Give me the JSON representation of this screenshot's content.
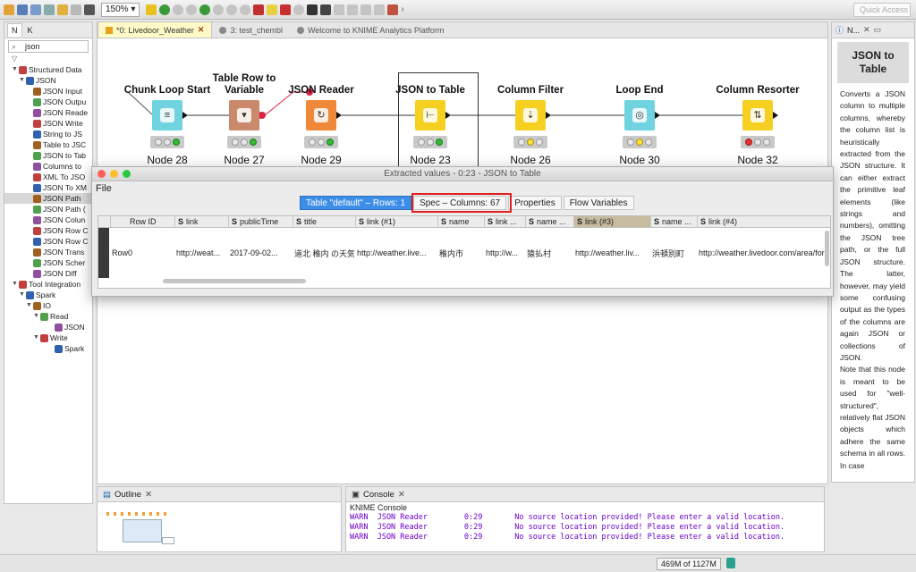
{
  "toolbar": {
    "zoom": "150%",
    "quick_access": "Quick Access"
  },
  "left_panel": {
    "tabs": [
      "N",
      "K"
    ],
    "search_value": "json",
    "tree": [
      {
        "label": "Structured Data",
        "indent": 1,
        "twisty": "▼"
      },
      {
        "label": "JSON",
        "indent": 2,
        "twisty": "▼"
      },
      {
        "label": "JSON Input",
        "indent": 3
      },
      {
        "label": "JSON Outpu",
        "indent": 3
      },
      {
        "label": "JSON Reade",
        "indent": 3
      },
      {
        "label": "JSON Write",
        "indent": 3
      },
      {
        "label": "String to JS",
        "indent": 3
      },
      {
        "label": "Table to JSC",
        "indent": 3
      },
      {
        "label": "JSON to Tab",
        "indent": 3
      },
      {
        "label": "Columns to",
        "indent": 3
      },
      {
        "label": "XML To JSO",
        "indent": 3
      },
      {
        "label": "JSON To XM",
        "indent": 3
      },
      {
        "label": "JSON Path",
        "indent": 3,
        "selected": true
      },
      {
        "label": "JSON Path (",
        "indent": 3
      },
      {
        "label": "JSON Colun",
        "indent": 3
      },
      {
        "label": "JSON Row C",
        "indent": 3
      },
      {
        "label": "JSON Row C",
        "indent": 3
      },
      {
        "label": "JSON Trans",
        "indent": 3
      },
      {
        "label": "JSON Scher",
        "indent": 3
      },
      {
        "label": "JSON Diff",
        "indent": 3
      },
      {
        "label": "Tool Integration",
        "indent": 1,
        "twisty": "▼"
      },
      {
        "label": "Spark",
        "indent": 2,
        "twisty": "▼"
      },
      {
        "label": "IO",
        "indent": 3,
        "twisty": "▼"
      },
      {
        "label": "Read",
        "indent": 4,
        "twisty": "▼"
      },
      {
        "label": "JSON",
        "indent": 6
      },
      {
        "label": "Write",
        "indent": 4,
        "twisty": "▼"
      },
      {
        "label": "Spark",
        "indent": 6
      }
    ]
  },
  "editor": {
    "tabs": [
      {
        "label": "*0: Livedoor_Weather",
        "active": true
      },
      {
        "label": "3: test_chembl",
        "active": false
      },
      {
        "label": "Welcome to KNIME Analytics Platform",
        "active": false
      }
    ]
  },
  "nodes": [
    {
      "title": "Chunk Loop Start",
      "label": "Node 28",
      "color": "#6fd4e0",
      "icon": "≡",
      "lights": [
        "off",
        "off",
        "green"
      ]
    },
    {
      "title": "Table Row to Variable",
      "label": "Node 27",
      "color": "#c9896a",
      "icon": "▾",
      "lights": [
        "off",
        "off",
        "green"
      ]
    },
    {
      "title": "JSON Reader",
      "label": "Node 29",
      "color": "#f0883a",
      "icon": "↻",
      "lights": [
        "off",
        "off",
        "green"
      ]
    },
    {
      "title": "JSON to Table",
      "label": "Node 23",
      "color": "#f6d020",
      "icon": "⊢",
      "lights": [
        "off",
        "off",
        "green"
      ]
    },
    {
      "title": "Column Filter",
      "label": "Node 26",
      "color": "#f6d020",
      "icon": "⇣",
      "lights": [
        "off",
        "yellow",
        "off"
      ]
    },
    {
      "title": "Loop End",
      "label": "Node 30",
      "color": "#6fd4e0",
      "icon": "◎",
      "lights": [
        "off",
        "yellow",
        "off"
      ]
    },
    {
      "title": "Column Resorter",
      "label": "Node 32",
      "color": "#f6d020",
      "icon": "⇅",
      "lights": [
        "red",
        "off",
        "off"
      ]
    }
  ],
  "dialog": {
    "title": "Extracted values - 0:23 - JSON to Table",
    "menu": "File",
    "tabs": [
      {
        "label": "Table \"default\" – Rows: 1",
        "active": true
      },
      {
        "label": "Spec – Columns: 67",
        "active": false
      },
      {
        "label": "Properties",
        "active": false
      },
      {
        "label": "Flow Variables",
        "active": false
      }
    ],
    "columns": [
      {
        "label": "Row ID",
        "s": false
      },
      {
        "label": "link",
        "s": true
      },
      {
        "label": "publicTime",
        "s": true
      },
      {
        "label": "title",
        "s": true
      },
      {
        "label": "link (#1)",
        "s": true
      },
      {
        "label": "name",
        "s": true
      },
      {
        "label": "link ...",
        "s": true
      },
      {
        "label": "name ...",
        "s": true
      },
      {
        "label": "link (#3)",
        "s": true
      },
      {
        "label": "name ...",
        "s": true
      },
      {
        "label": "link (#4)",
        "s": true
      }
    ],
    "row": [
      "Row0",
      "http://weat...",
      "2017-09-02...",
      "道北 稚内 の天気",
      "http://weather.live...",
      "稚内市",
      "http://w...",
      "猿払村",
      "http://weather.liv...",
      "浜頓別町",
      "http://weather.livedoor.com/area/fore"
    ]
  },
  "right_panel": {
    "tabs": [
      "N..."
    ],
    "title": "JSON to Table",
    "description": "Converts a JSON column to multiple columns, whereby the column list is heuristically extracted from the JSON structure. It can either extract the primitive leaf elements (like strings and numbers), omitting the JSON tree path, or the full JSON structure. The latter, however, may yield some confusing output as the types of the columns are again JSON or collections of JSON.",
    "note": "Note that this node is meant to be used for \"well-structured\", relatively flat JSON objects which adhere the same schema in all rows. In case"
  },
  "outline": {
    "title": "Outline"
  },
  "console": {
    "title": "Console",
    "subtitle": "KNIME Console",
    "lines": [
      "WARN  JSON Reader        0:29       No source location provided! Please enter a valid location.",
      "WARN  JSON Reader        0:29       No source location provided! Please enter a valid location.",
      "WARN  JSON Reader        0:29       No source location provided! Please enter a valid location."
    ]
  },
  "status": {
    "memory_used": "469M",
    "memory_total": "of 1127M"
  }
}
